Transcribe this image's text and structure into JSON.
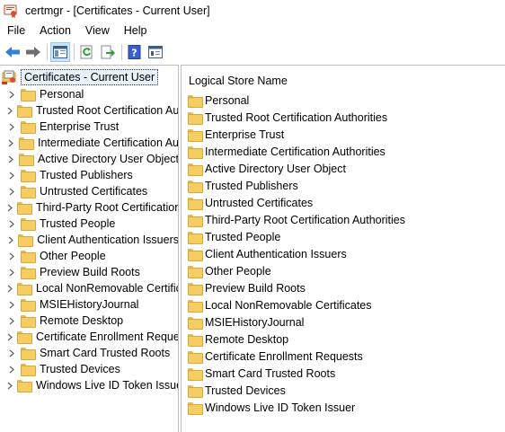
{
  "window": {
    "title": "certmgr - [Certificates - Current User]"
  },
  "menu": [
    "File",
    "Action",
    "View",
    "Help"
  ],
  "toolbar": {
    "icons": [
      "back-arrow-icon",
      "forward-arrow-icon",
      "show-hide-tree-icon",
      "refresh-icon",
      "export-list-icon",
      "help-icon",
      "properties-icon"
    ]
  },
  "tree": {
    "root_label": "Certificates - Current User",
    "items": [
      {
        "label": "Personal"
      },
      {
        "label": "Trusted Root Certification Au"
      },
      {
        "label": "Enterprise Trust"
      },
      {
        "label": "Intermediate Certification Au"
      },
      {
        "label": "Active Directory User Object"
      },
      {
        "label": "Trusted Publishers"
      },
      {
        "label": "Untrusted Certificates"
      },
      {
        "label": "Third-Party Root Certification"
      },
      {
        "label": "Trusted People"
      },
      {
        "label": "Client Authentication Issuers"
      },
      {
        "label": "Other People"
      },
      {
        "label": "Preview Build Roots"
      },
      {
        "label": "Local NonRemovable Certific"
      },
      {
        "label": "MSIEHistoryJournal"
      },
      {
        "label": "Remote Desktop"
      },
      {
        "label": "Certificate Enrollment Reques"
      },
      {
        "label": "Smart Card Trusted Roots"
      },
      {
        "label": "Trusted Devices"
      },
      {
        "label": "Windows Live ID Token Issuer"
      }
    ]
  },
  "list": {
    "column_header": "Logical Store Name",
    "items": [
      {
        "label": "Personal"
      },
      {
        "label": "Trusted Root Certification Authorities"
      },
      {
        "label": "Enterprise Trust"
      },
      {
        "label": "Intermediate Certification Authorities"
      },
      {
        "label": "Active Directory User Object"
      },
      {
        "label": "Trusted Publishers"
      },
      {
        "label": "Untrusted Certificates"
      },
      {
        "label": "Third-Party Root Certification Authorities"
      },
      {
        "label": "Trusted People"
      },
      {
        "label": "Client Authentication Issuers"
      },
      {
        "label": "Other People"
      },
      {
        "label": "Preview Build Roots"
      },
      {
        "label": "Local NonRemovable Certificates"
      },
      {
        "label": "MSIEHistoryJournal"
      },
      {
        "label": "Remote Desktop"
      },
      {
        "label": "Certificate Enrollment Requests"
      },
      {
        "label": "Smart Card Trusted Roots"
      },
      {
        "label": "Trusted Devices"
      },
      {
        "label": "Windows Live ID Token Issuer"
      }
    ]
  },
  "colors": {
    "selection": "#e5f1fb",
    "pressed_button": "#cce4f7",
    "folder": "#f5cd63",
    "nav_arrow": "#2f7fd6"
  }
}
